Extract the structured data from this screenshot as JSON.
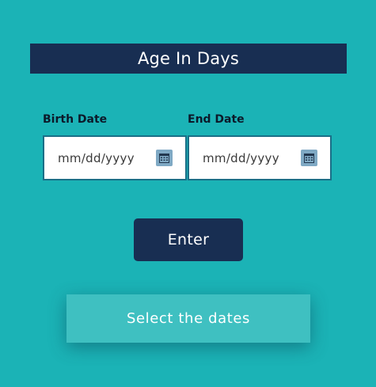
{
  "app": {
    "title": "Age In Days"
  },
  "form": {
    "birth_date": {
      "label": "Birth Date",
      "placeholder": "mm/dd/yyyy",
      "icon": "calendar-icon"
    },
    "end_date": {
      "label": "End Date",
      "placeholder": "mm/dd/yyyy",
      "icon": "calendar-icon"
    },
    "submit_label": "Enter"
  },
  "result": {
    "text": "Select the dates"
  },
  "colors": {
    "background": "#1bb3b6",
    "navy": "#182e52",
    "result_box": "#3fc0c1",
    "field_border": "#1a6f87",
    "icon_bg": "#7fa9c4"
  }
}
